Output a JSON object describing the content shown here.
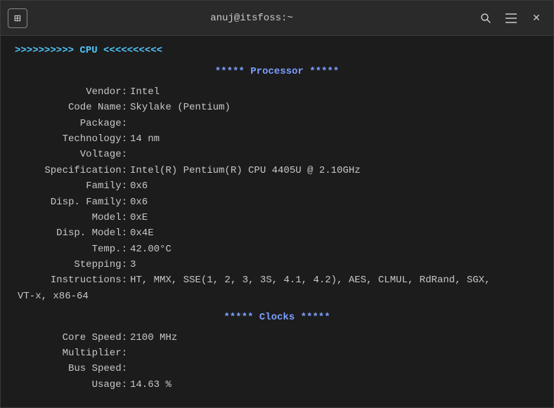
{
  "titlebar": {
    "title": "anuj@itsfoss:~",
    "new_tab_icon": "⊞",
    "search_icon": "🔍",
    "menu_icon": "☰",
    "close_icon": "✕"
  },
  "terminal": {
    "cpu_header": ">>>>>>>>>>  CPU  <<<<<<<<<<",
    "processor_header": "***** Processor *****",
    "fields": [
      {
        "label": "Vendor:",
        "value": "Intel"
      },
      {
        "label": "Code Name:",
        "value": "Skylake (Pentium)"
      },
      {
        "label": "Package:",
        "value": ""
      },
      {
        "label": "Technology:",
        "value": "14 nm"
      },
      {
        "label": "Voltage:",
        "value": ""
      },
      {
        "label": "Specification:",
        "value": "Intel(R) Pentium(R) CPU 4405U @ 2.10GHz"
      },
      {
        "label": "Family:",
        "value": "0x6"
      },
      {
        "label": "Disp. Family:",
        "value": "0x6"
      },
      {
        "label": "Model:",
        "value": "0xE"
      },
      {
        "label": "Disp. Model:",
        "value": "0x4E"
      },
      {
        "label": "Temp.:",
        "value": "42.00°C"
      },
      {
        "label": "Stepping:",
        "value": "3"
      },
      {
        "label": "Instructions:",
        "value": "HT, MMX, SSE(1, 2, 3, 3S, 4.1, 4.2), AES, CLMUL, RdRand, SGX, VT-x, x86-64"
      }
    ],
    "clocks_header": "***** Clocks *****",
    "clocks_fields": [
      {
        "label": "Core Speed:",
        "value": "2100 MHz"
      },
      {
        "label": "Multiplier:",
        "value": ""
      },
      {
        "label": "Bus Speed:",
        "value": ""
      },
      {
        "label": "Usage:",
        "value": " 14.63 %"
      }
    ]
  }
}
